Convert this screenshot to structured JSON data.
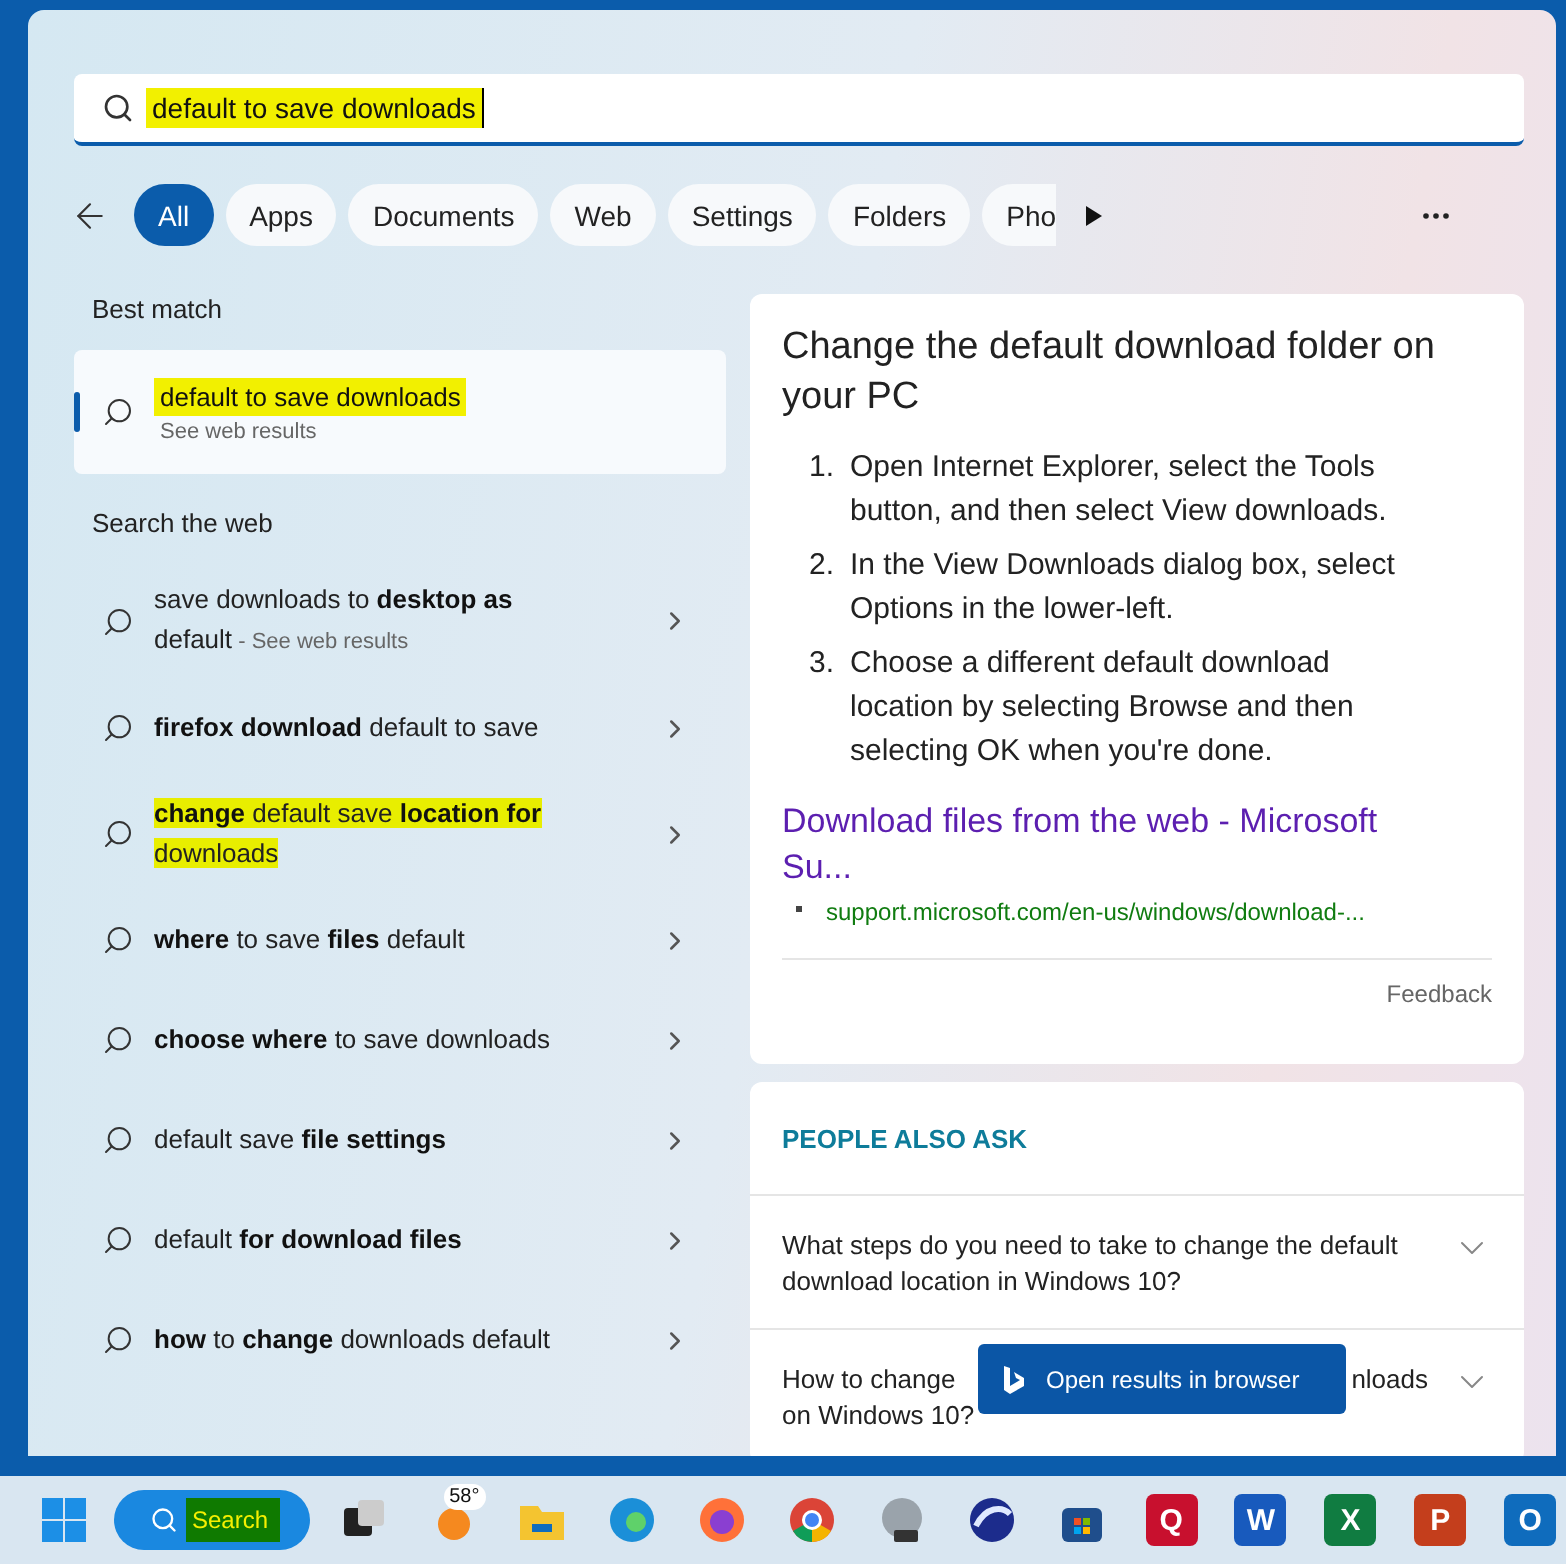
{
  "search": {
    "value": "default to save downloads",
    "highlighted": true
  },
  "filters": [
    {
      "label": "All",
      "selected": true
    },
    {
      "label": "Apps",
      "selected": false
    },
    {
      "label": "Documents",
      "selected": false
    },
    {
      "label": "Web",
      "selected": false
    },
    {
      "label": "Settings",
      "selected": false
    },
    {
      "label": "Folders",
      "selected": false
    },
    {
      "label": "Pho",
      "selected": false
    }
  ],
  "best_match": {
    "heading": "Best match",
    "title": "default to save downloads",
    "subtitle": "See web results",
    "highlighted": true,
    "selected": true
  },
  "web": {
    "heading": "Search the web",
    "suggestions": [
      {
        "text": "save downloads to **desktop as** default",
        "note": " - See web results",
        "highlighted": false
      },
      {
        "text": "**firefox download** default to save",
        "highlighted": false
      },
      {
        "text": "**change** default save **location for** downloads",
        "highlighted": true
      },
      {
        "text": "**where** to save **files** default",
        "highlighted": false
      },
      {
        "text": "**choose where** to save downloads",
        "highlighted": false
      },
      {
        "text": "default save **file settings**",
        "highlighted": false
      },
      {
        "text": "default **for download files**",
        "highlighted": false
      },
      {
        "text": "**how** to **change** downloads default",
        "highlighted": false
      }
    ]
  },
  "answer": {
    "title": "Change the default download folder on your PC",
    "steps": [
      {
        "number": "1.",
        "text": "Open Internet Explorer, select the Tools button, and then select View downloads."
      },
      {
        "number": "2.",
        "text": "In the View Downloads dialog box, select Options in the lower-left."
      },
      {
        "number": "3.",
        "text": "Choose a different default download location by selecting Browse and then selecting OK when you're done."
      }
    ],
    "link": "Download files from the web - Microsoft Su...",
    "url": "support.microsoft.com/en-us/windows/download-...",
    "feedback": "Feedback"
  },
  "people_also_ask": {
    "heading": "PEOPLE ALSO ASK",
    "questions": [
      {
        "start": "What steps do you need to take to change the default download location in Windows 10?",
        "expanded": false
      },
      {
        "start": "How to change",
        "end": "nloads",
        "line_2": "on Windows 10?",
        "expanded": false
      }
    ]
  },
  "open_in_browser": "Open results in browser",
  "taskbar": {
    "search": {
      "label": "Search",
      "highlighted": true
    },
    "weather": "58°",
    "apps": [
      {
        "kind": "taskview"
      },
      {
        "kind": "weather"
      },
      {
        "kind": "explorer"
      },
      {
        "kind": "edge"
      },
      {
        "kind": "firefox"
      },
      {
        "kind": "chrome"
      },
      {
        "kind": "earth"
      },
      {
        "kind": "seamonkey"
      },
      {
        "kind": "store"
      },
      {
        "kind": "tile",
        "glyph": "Q",
        "color": "#c8102e"
      },
      {
        "kind": "tile",
        "glyph": "W",
        "color": "#185abd"
      },
      {
        "kind": "tile",
        "glyph": "X",
        "color": "#107c41"
      },
      {
        "kind": "tile",
        "glyph": "P",
        "color": "#c43e1c"
      },
      {
        "kind": "tile",
        "glyph": "O",
        "color": "#0f6cbd"
      }
    ]
  }
}
